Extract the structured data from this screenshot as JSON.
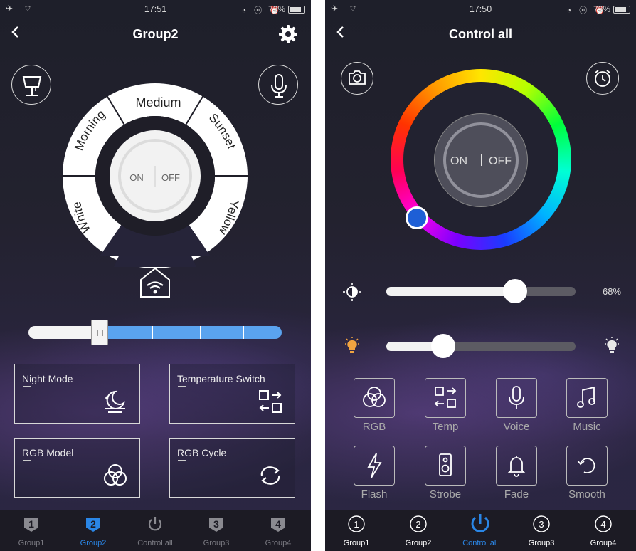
{
  "status_left": {
    "time": "17:51",
    "battery": "73%"
  },
  "status_right": {
    "time": "17:50",
    "battery": "73%"
  },
  "left": {
    "title": "Group2",
    "icons": {
      "back": "chevron-left-icon",
      "settings": "gear-icon",
      "lamp": "lamp-icon",
      "mic": "microphone-icon",
      "wifi_home": "wifi-home-icon"
    },
    "arc_labels": {
      "medium": "Medium",
      "morning": "Morning",
      "sunset": "Sunset",
      "white": "White",
      "yellow": "Yellow"
    },
    "power": {
      "on": "ON",
      "off": "OFF"
    },
    "slider_level": 0.28,
    "panels": [
      {
        "label": "Night Mode",
        "icon": "night-mode-icon"
      },
      {
        "label": "Temperature Switch",
        "icon": "temperature-switch-icon"
      },
      {
        "label": "RGB Model",
        "icon": "rgb-model-icon"
      },
      {
        "label": "RGB Cycle",
        "icon": "rgb-cycle-icon"
      }
    ],
    "tabs": [
      {
        "label": "Group1",
        "badge": "1",
        "active": false
      },
      {
        "label": "Group2",
        "badge": "2",
        "active": true
      },
      {
        "label": "Control all",
        "badge": "",
        "active": false
      },
      {
        "label": "Group3",
        "badge": "3",
        "active": false
      },
      {
        "label": "Group4",
        "badge": "4",
        "active": false
      }
    ]
  },
  "right": {
    "title": "Control all",
    "icons": {
      "back": "chevron-left-icon",
      "camera": "camera-icon",
      "alarm": "alarm-clock-icon"
    },
    "power": {
      "on": "ON",
      "off": "OFF"
    },
    "brightness": {
      "value": 0.68,
      "label": "68%"
    },
    "temperature_level": 0.3,
    "modes": [
      {
        "label": "RGB",
        "icon": "rgb-icon"
      },
      {
        "label": "Temp",
        "icon": "temp-switch-icon"
      },
      {
        "label": "Voice",
        "icon": "microphone-icon"
      },
      {
        "label": "Music",
        "icon": "music-note-icon"
      },
      {
        "label": "Flash",
        "icon": "lightning-icon"
      },
      {
        "label": "Strobe",
        "icon": "speaker-icon"
      },
      {
        "label": "Fade",
        "icon": "bell-icon"
      },
      {
        "label": "Smooth",
        "icon": "rotate-icon"
      }
    ],
    "tabs": [
      {
        "label": "Group1",
        "badge": "1",
        "active": false
      },
      {
        "label": "Group2",
        "badge": "2",
        "active": false
      },
      {
        "label": "Control all",
        "badge": "",
        "active": true
      },
      {
        "label": "Group3",
        "badge": "3",
        "active": false
      },
      {
        "label": "Group4",
        "badge": "4",
        "active": false
      }
    ]
  },
  "colors": {
    "accent": "#2a86e6",
    "slider_blue": "#5aa3ef",
    "color_thumb": "#1e5fd6"
  }
}
